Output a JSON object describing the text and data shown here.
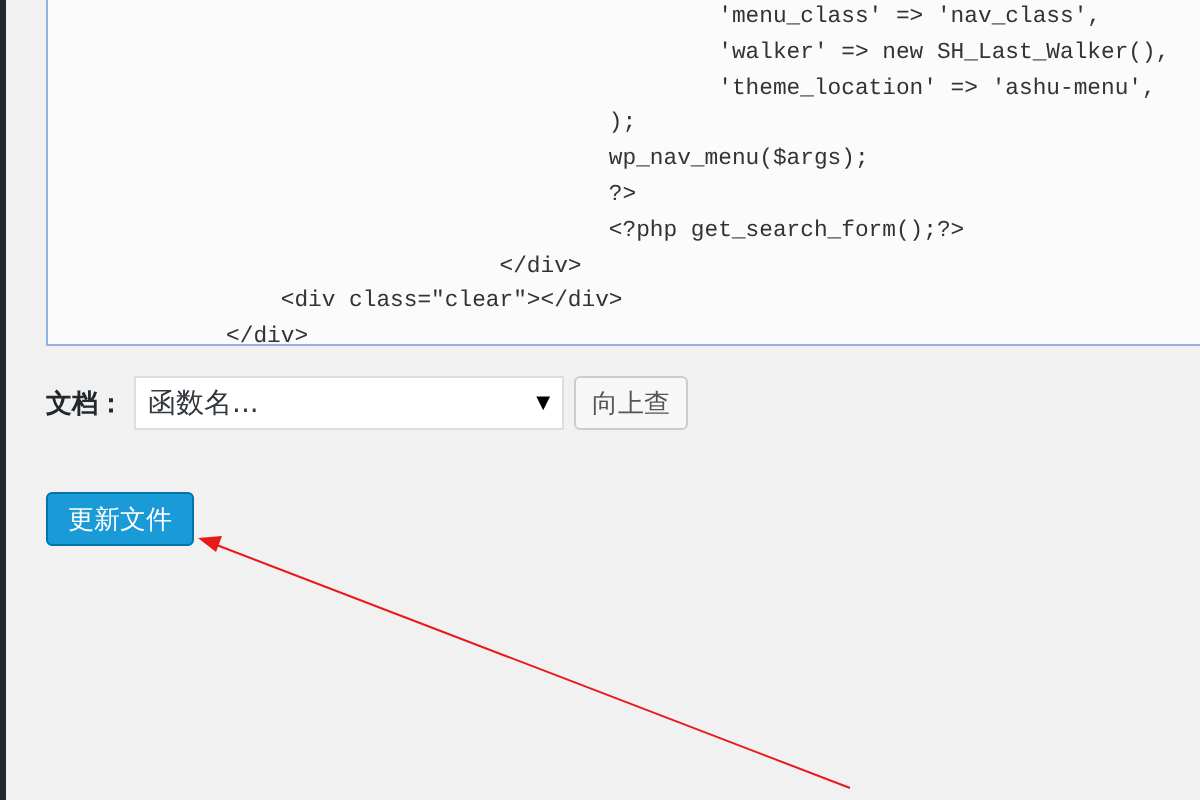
{
  "editor": {
    "lines": [
      "                                                'menu_class' => 'nav_class',",
      "                                                'walker' => new SH_Last_Walker(),",
      "                                                'theme_location' => 'ashu-menu',",
      "                                        );",
      "                                        wp_nav_menu($args);",
      "                                        ?>",
      "                                        <?php get_search_form();?>",
      "                                </div>",
      "                <div class=\"clear\"></div>",
      "            </div>"
    ]
  },
  "docs": {
    "label": "文档：",
    "select_value": "函数名...",
    "caret": "▼",
    "lookup_button": "向上查"
  },
  "update_button": "更新文件"
}
